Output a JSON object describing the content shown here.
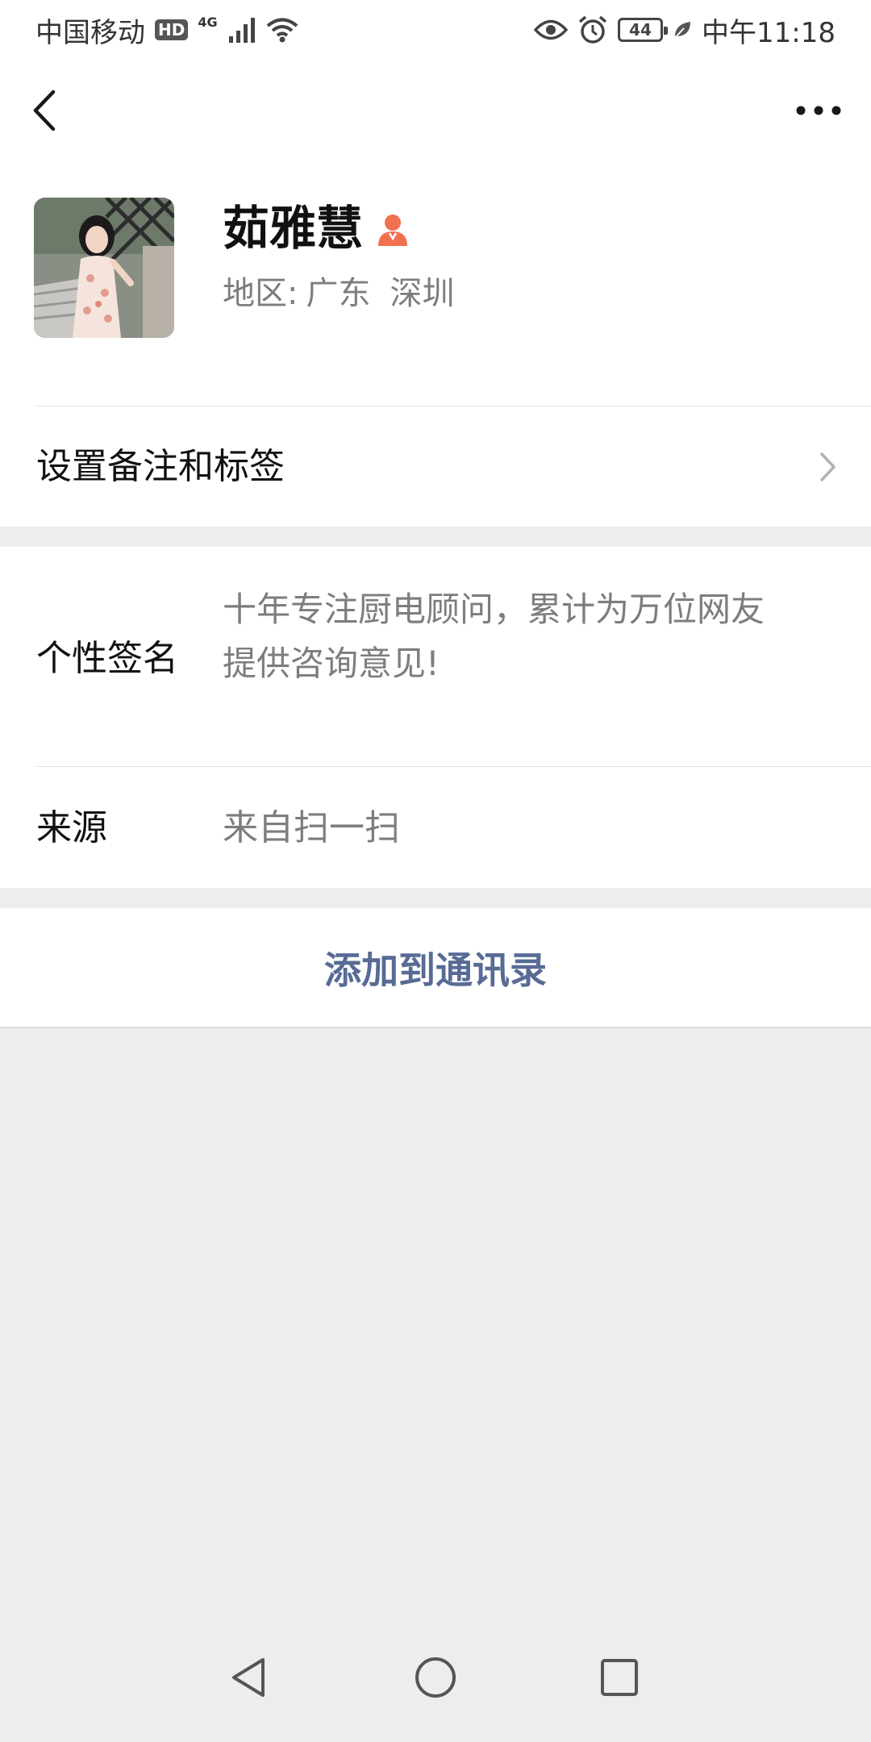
{
  "status_bar": {
    "carrier": "中国移动",
    "hd_badge": "HD",
    "network": "4G",
    "battery": "44",
    "time": "中午11:18",
    "icons": [
      "signal-icon",
      "wifi-icon",
      "eye-icon",
      "alarm-icon",
      "battery-icon",
      "leaf-icon"
    ]
  },
  "nav": {
    "icons": [
      "back-arrow-icon",
      "more-dots-icon"
    ]
  },
  "profile": {
    "name": "茹雅慧",
    "gender_icon": "female-icon",
    "gender_color": "#f0704f",
    "region_label": "地区:",
    "region_province": "广东",
    "region_city": "深圳",
    "remark_label": "设置备注和标签"
  },
  "info": {
    "signature_label": "个性签名",
    "signature_line1": "十年专注厨电顾问，累计为万位网友",
    "signature_line2": "提供咨询意见!",
    "source_label": "来源",
    "source_value": "来自扫一扫"
  },
  "actions": {
    "add_contact": "添加到通讯录",
    "accent_color": "#576b95"
  },
  "system_nav": {
    "icons": [
      "back-triangle-icon",
      "home-circle-icon",
      "recents-square-icon"
    ]
  }
}
